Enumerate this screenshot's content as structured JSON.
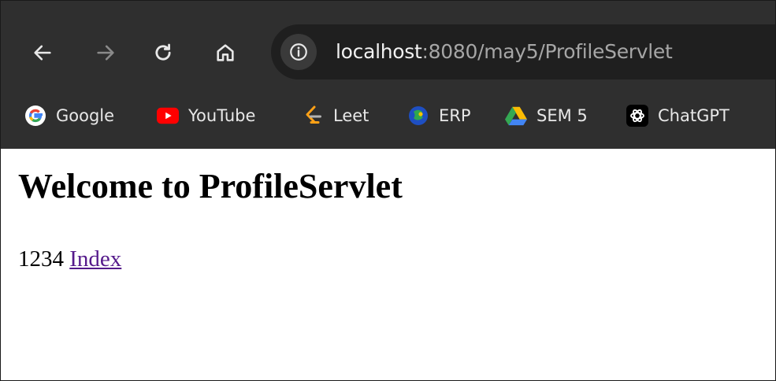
{
  "browser": {
    "address_bar": {
      "host": "localhost",
      "rest": ":8080/may5/ProfileServlet"
    },
    "bookmarks": [
      {
        "label": "Google",
        "icon": "google-icon"
      },
      {
        "label": "YouTube",
        "icon": "youtube-icon"
      },
      {
        "label": "Leet",
        "icon": "leetcode-icon"
      },
      {
        "label": "ERP",
        "icon": "erp-icon"
      },
      {
        "label": "SEM 5",
        "icon": "google-drive-icon"
      },
      {
        "label": "ChatGPT",
        "icon": "chatgpt-icon"
      }
    ],
    "colors": {
      "chrome": "#2f2f2f",
      "omnibox": "#1f1f1f",
      "visited_link": "#551a8b"
    }
  },
  "page": {
    "title": "Welcome to ProfileServlet",
    "value": "1234",
    "link_label": "Index"
  }
}
